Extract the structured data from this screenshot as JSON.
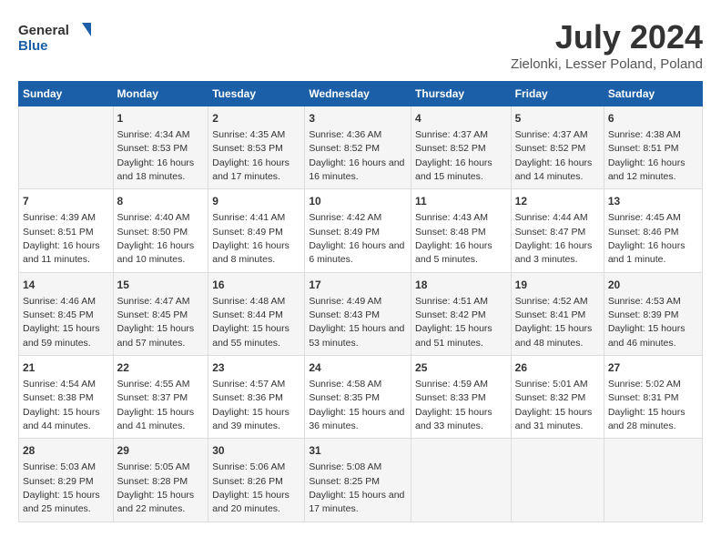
{
  "logo": {
    "line1": "General",
    "line2": "Blue"
  },
  "title": "July 2024",
  "subtitle": "Zielonki, Lesser Poland, Poland",
  "weekdays": [
    "Sunday",
    "Monday",
    "Tuesday",
    "Wednesday",
    "Thursday",
    "Friday",
    "Saturday"
  ],
  "weeks": [
    [
      {
        "day": "",
        "sunrise": "",
        "sunset": "",
        "daylight": ""
      },
      {
        "day": "1",
        "sunrise": "Sunrise: 4:34 AM",
        "sunset": "Sunset: 8:53 PM",
        "daylight": "Daylight: 16 hours and 18 minutes."
      },
      {
        "day": "2",
        "sunrise": "Sunrise: 4:35 AM",
        "sunset": "Sunset: 8:53 PM",
        "daylight": "Daylight: 16 hours and 17 minutes."
      },
      {
        "day": "3",
        "sunrise": "Sunrise: 4:36 AM",
        "sunset": "Sunset: 8:52 PM",
        "daylight": "Daylight: 16 hours and 16 minutes."
      },
      {
        "day": "4",
        "sunrise": "Sunrise: 4:37 AM",
        "sunset": "Sunset: 8:52 PM",
        "daylight": "Daylight: 16 hours and 15 minutes."
      },
      {
        "day": "5",
        "sunrise": "Sunrise: 4:37 AM",
        "sunset": "Sunset: 8:52 PM",
        "daylight": "Daylight: 16 hours and 14 minutes."
      },
      {
        "day": "6",
        "sunrise": "Sunrise: 4:38 AM",
        "sunset": "Sunset: 8:51 PM",
        "daylight": "Daylight: 16 hours and 12 minutes."
      }
    ],
    [
      {
        "day": "7",
        "sunrise": "Sunrise: 4:39 AM",
        "sunset": "Sunset: 8:51 PM",
        "daylight": "Daylight: 16 hours and 11 minutes."
      },
      {
        "day": "8",
        "sunrise": "Sunrise: 4:40 AM",
        "sunset": "Sunset: 8:50 PM",
        "daylight": "Daylight: 16 hours and 10 minutes."
      },
      {
        "day": "9",
        "sunrise": "Sunrise: 4:41 AM",
        "sunset": "Sunset: 8:49 PM",
        "daylight": "Daylight: 16 hours and 8 minutes."
      },
      {
        "day": "10",
        "sunrise": "Sunrise: 4:42 AM",
        "sunset": "Sunset: 8:49 PM",
        "daylight": "Daylight: 16 hours and 6 minutes."
      },
      {
        "day": "11",
        "sunrise": "Sunrise: 4:43 AM",
        "sunset": "Sunset: 8:48 PM",
        "daylight": "Daylight: 16 hours and 5 minutes."
      },
      {
        "day": "12",
        "sunrise": "Sunrise: 4:44 AM",
        "sunset": "Sunset: 8:47 PM",
        "daylight": "Daylight: 16 hours and 3 minutes."
      },
      {
        "day": "13",
        "sunrise": "Sunrise: 4:45 AM",
        "sunset": "Sunset: 8:46 PM",
        "daylight": "Daylight: 16 hours and 1 minute."
      }
    ],
    [
      {
        "day": "14",
        "sunrise": "Sunrise: 4:46 AM",
        "sunset": "Sunset: 8:45 PM",
        "daylight": "Daylight: 15 hours and 59 minutes."
      },
      {
        "day": "15",
        "sunrise": "Sunrise: 4:47 AM",
        "sunset": "Sunset: 8:45 PM",
        "daylight": "Daylight: 15 hours and 57 minutes."
      },
      {
        "day": "16",
        "sunrise": "Sunrise: 4:48 AM",
        "sunset": "Sunset: 8:44 PM",
        "daylight": "Daylight: 15 hours and 55 minutes."
      },
      {
        "day": "17",
        "sunrise": "Sunrise: 4:49 AM",
        "sunset": "Sunset: 8:43 PM",
        "daylight": "Daylight: 15 hours and 53 minutes."
      },
      {
        "day": "18",
        "sunrise": "Sunrise: 4:51 AM",
        "sunset": "Sunset: 8:42 PM",
        "daylight": "Daylight: 15 hours and 51 minutes."
      },
      {
        "day": "19",
        "sunrise": "Sunrise: 4:52 AM",
        "sunset": "Sunset: 8:41 PM",
        "daylight": "Daylight: 15 hours and 48 minutes."
      },
      {
        "day": "20",
        "sunrise": "Sunrise: 4:53 AM",
        "sunset": "Sunset: 8:39 PM",
        "daylight": "Daylight: 15 hours and 46 minutes."
      }
    ],
    [
      {
        "day": "21",
        "sunrise": "Sunrise: 4:54 AM",
        "sunset": "Sunset: 8:38 PM",
        "daylight": "Daylight: 15 hours and 44 minutes."
      },
      {
        "day": "22",
        "sunrise": "Sunrise: 4:55 AM",
        "sunset": "Sunset: 8:37 PM",
        "daylight": "Daylight: 15 hours and 41 minutes."
      },
      {
        "day": "23",
        "sunrise": "Sunrise: 4:57 AM",
        "sunset": "Sunset: 8:36 PM",
        "daylight": "Daylight: 15 hours and 39 minutes."
      },
      {
        "day": "24",
        "sunrise": "Sunrise: 4:58 AM",
        "sunset": "Sunset: 8:35 PM",
        "daylight": "Daylight: 15 hours and 36 minutes."
      },
      {
        "day": "25",
        "sunrise": "Sunrise: 4:59 AM",
        "sunset": "Sunset: 8:33 PM",
        "daylight": "Daylight: 15 hours and 33 minutes."
      },
      {
        "day": "26",
        "sunrise": "Sunrise: 5:01 AM",
        "sunset": "Sunset: 8:32 PM",
        "daylight": "Daylight: 15 hours and 31 minutes."
      },
      {
        "day": "27",
        "sunrise": "Sunrise: 5:02 AM",
        "sunset": "Sunset: 8:31 PM",
        "daylight": "Daylight: 15 hours and 28 minutes."
      }
    ],
    [
      {
        "day": "28",
        "sunrise": "Sunrise: 5:03 AM",
        "sunset": "Sunset: 8:29 PM",
        "daylight": "Daylight: 15 hours and 25 minutes."
      },
      {
        "day": "29",
        "sunrise": "Sunrise: 5:05 AM",
        "sunset": "Sunset: 8:28 PM",
        "daylight": "Daylight: 15 hours and 22 minutes."
      },
      {
        "day": "30",
        "sunrise": "Sunrise: 5:06 AM",
        "sunset": "Sunset: 8:26 PM",
        "daylight": "Daylight: 15 hours and 20 minutes."
      },
      {
        "day": "31",
        "sunrise": "Sunrise: 5:08 AM",
        "sunset": "Sunset: 8:25 PM",
        "daylight": "Daylight: 15 hours and 17 minutes."
      },
      {
        "day": "",
        "sunrise": "",
        "sunset": "",
        "daylight": ""
      },
      {
        "day": "",
        "sunrise": "",
        "sunset": "",
        "daylight": ""
      },
      {
        "day": "",
        "sunrise": "",
        "sunset": "",
        "daylight": ""
      }
    ]
  ]
}
